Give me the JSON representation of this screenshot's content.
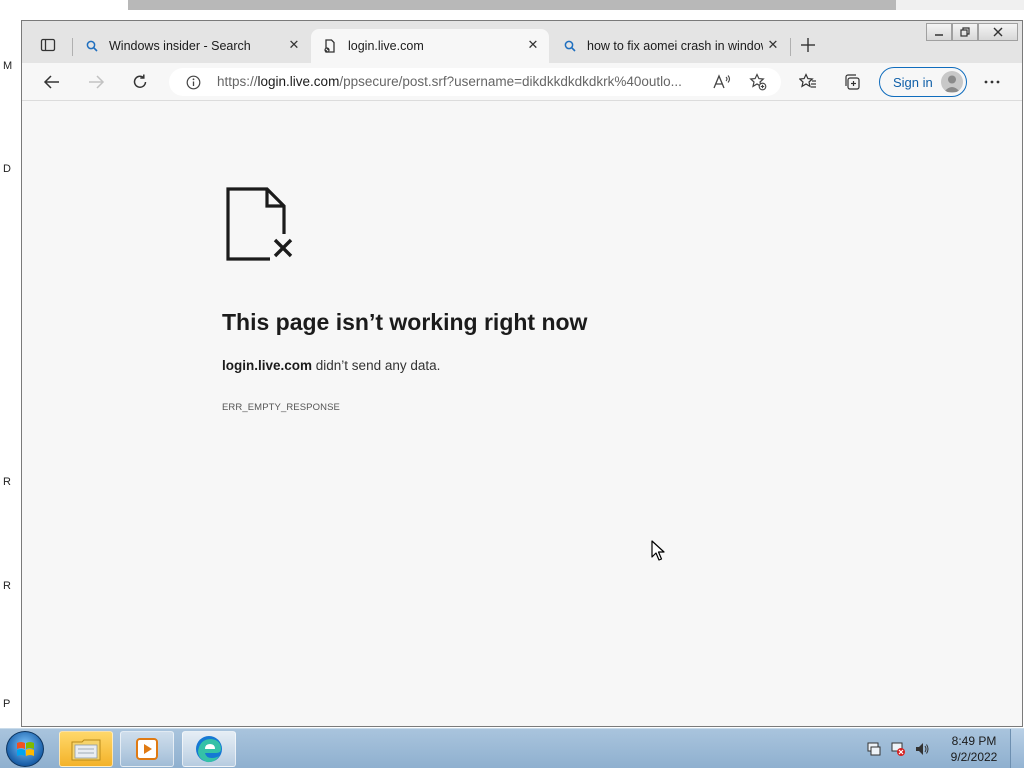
{
  "desktop": {
    "side_letters": [
      "M",
      "D",
      "R",
      "R",
      "P"
    ]
  },
  "browser": {
    "tabs": [
      {
        "label": "Windows insider - Search",
        "icon": "search-icon",
        "active": false
      },
      {
        "label": "login.live.com",
        "icon": "page-error-icon",
        "active": true
      },
      {
        "label": "how to fix aomei crash in windows",
        "icon": "search-icon",
        "active": false
      }
    ],
    "url": {
      "prefix": "https://",
      "host": "login.live.com",
      "path": "/ppsecure/post.srf?username=dikdkkdkdkdkrk%40outlo..."
    },
    "signin_label": "Sign in"
  },
  "error_page": {
    "title": "This page isn’t working right now",
    "host": "login.live.com",
    "message": " didn’t send any data.",
    "code": "ERR_EMPTY_RESPONSE"
  },
  "taskbar": {
    "time": "8:49 PM",
    "date": "9/2/2022"
  },
  "colors": {
    "accent": "#0f6cbd",
    "page_bg": "#f7f7f7",
    "tabstrip_bg": "#e4e4e4"
  }
}
